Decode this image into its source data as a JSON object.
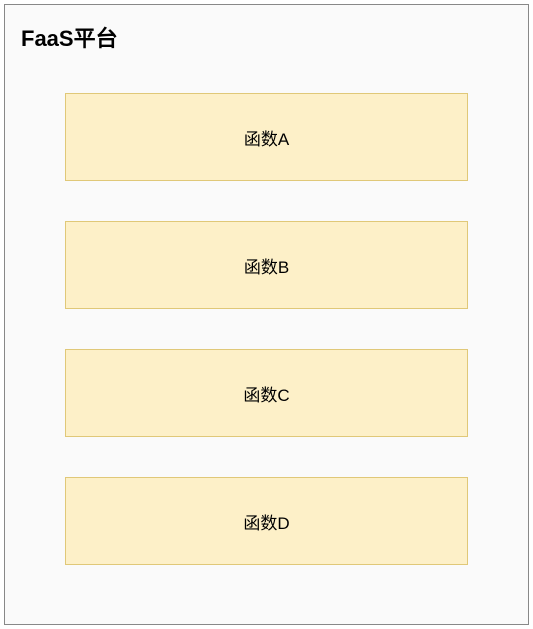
{
  "platform": {
    "title": "FaaS平台",
    "functions": [
      {
        "label": "函数A"
      },
      {
        "label": "函数B"
      },
      {
        "label": "函数C"
      },
      {
        "label": "函数D"
      }
    ]
  },
  "colors": {
    "container_border": "#888888",
    "container_bg": "#fafafa",
    "box_bg": "#fdf0c8",
    "box_border": "#e0c878"
  }
}
